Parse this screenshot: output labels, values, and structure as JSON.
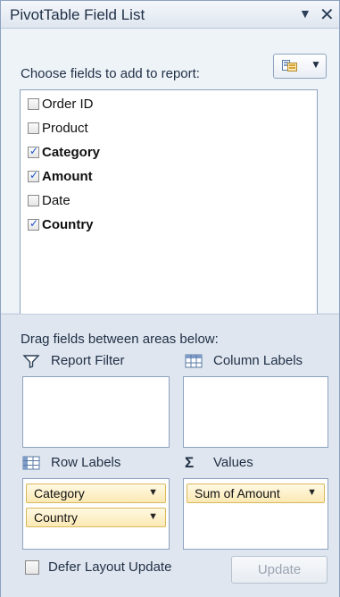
{
  "panel": {
    "title": "PivotTable Field List",
    "dropdown_glyph": "▼",
    "close_glyph": "✕"
  },
  "choose_label": "Choose fields to add to report:",
  "layout_button": {
    "icon": "field-list-layout-icon",
    "caret": "▼"
  },
  "fields": [
    {
      "label": "Order ID",
      "checked": false
    },
    {
      "label": "Product",
      "checked": false
    },
    {
      "label": "Category",
      "checked": true
    },
    {
      "label": "Amount",
      "checked": true
    },
    {
      "label": "Date",
      "checked": false
    },
    {
      "label": "Country",
      "checked": true
    }
  ],
  "drag_hint": "Drag fields between areas below:",
  "areas": {
    "report_filter": {
      "label": "Report Filter",
      "icon": "filter-icon",
      "items": []
    },
    "column_labels": {
      "label": "Column Labels",
      "icon": "column-labels-icon",
      "items": []
    },
    "row_labels": {
      "label": "Row Labels",
      "icon": "row-labels-icon",
      "items": [
        "Category",
        "Country"
      ]
    },
    "values": {
      "label": "Values",
      "icon": "sigma-icon",
      "glyph": "Σ",
      "items": [
        "Sum of Amount"
      ]
    }
  },
  "chip_dropdown_glyph": "▼",
  "defer_label": "Defer Layout Update",
  "defer_checked": false,
  "update_label": "Update",
  "colors": {
    "accent_border": "#8da2bf",
    "chip_fill": "#fbe9b4",
    "chip_border": "#d9b85c",
    "pane_bg": "#dfe6ef"
  }
}
